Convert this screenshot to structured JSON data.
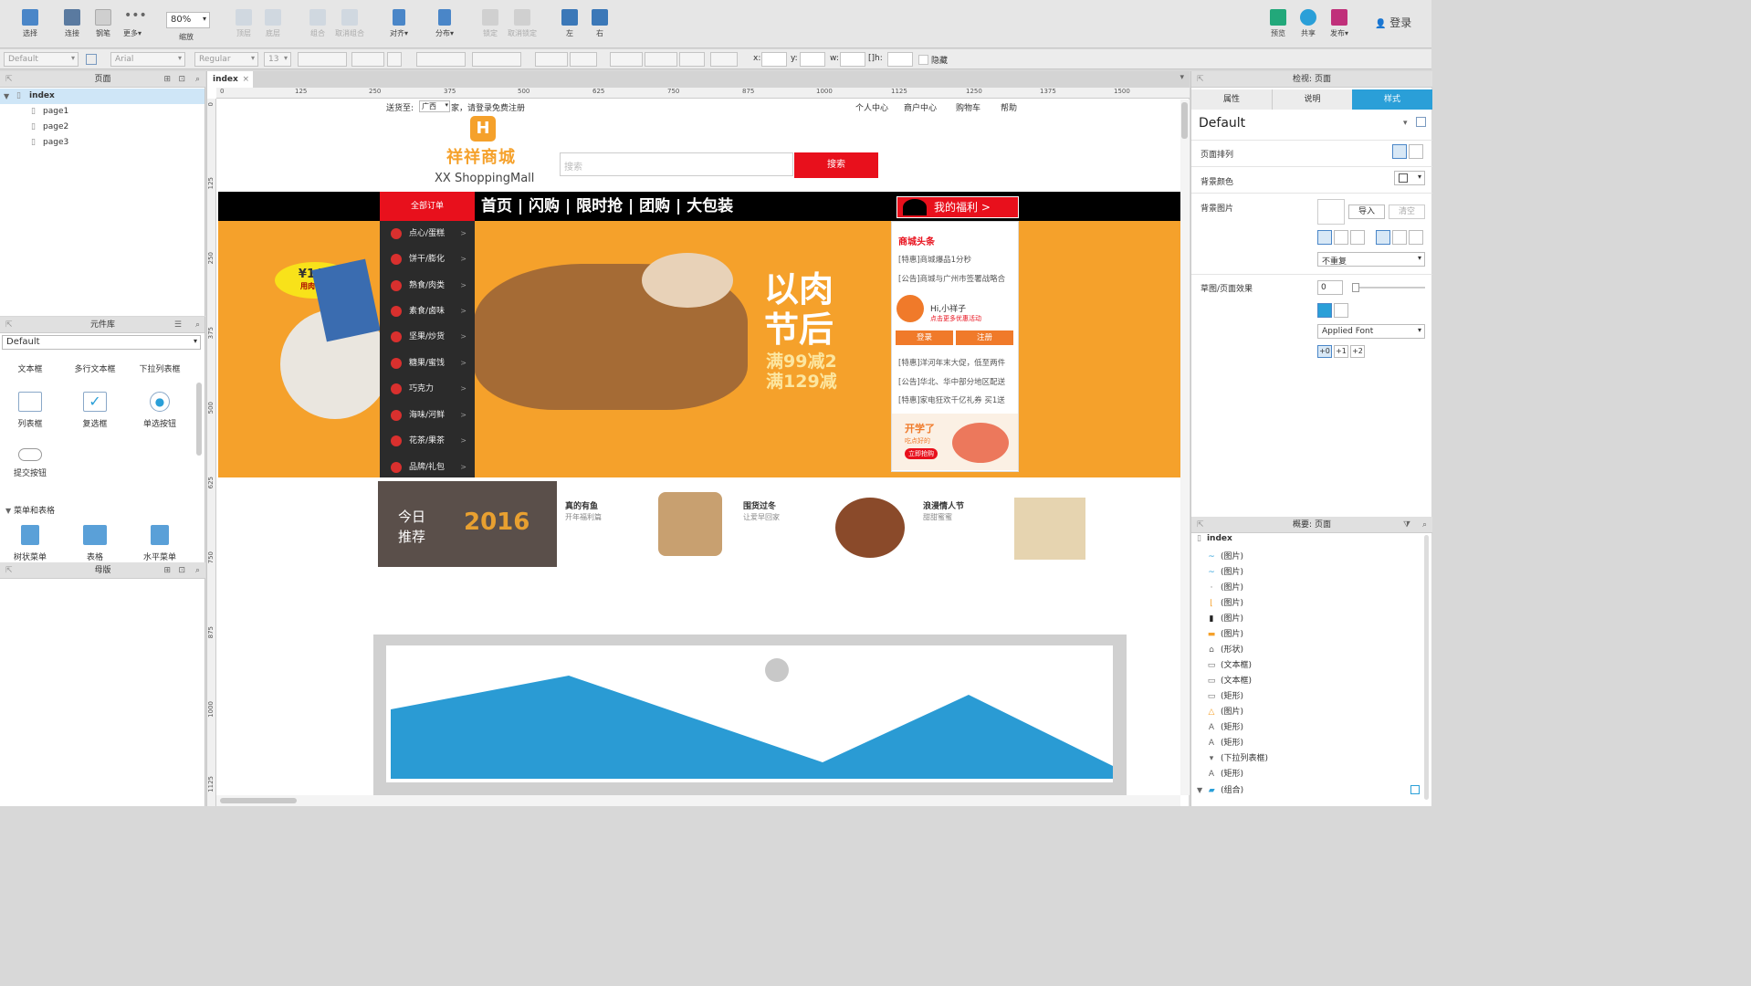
{
  "toolbar": {
    "items": [
      {
        "label": "选择",
        "icon": "select-icon"
      },
      {
        "label": "连接",
        "icon": "connect-icon"
      },
      {
        "label": "钢笔",
        "icon": "pen-icon"
      },
      {
        "label": "更多▾",
        "icon": "more-icon"
      },
      {
        "label": "缩放",
        "icon": "zoom-icon"
      },
      {
        "label": "顶层",
        "icon": "bring-front-icon"
      },
      {
        "label": "底层",
        "icon": "send-back-icon"
      },
      {
        "label": "组合",
        "icon": "group-icon"
      },
      {
        "label": "取消组合",
        "icon": "ungroup-icon"
      },
      {
        "label": "对齐▾",
        "icon": "align-icon"
      },
      {
        "label": "分布▾",
        "icon": "distribute-icon"
      },
      {
        "label": "锁定",
        "icon": "lock-icon"
      },
      {
        "label": "取消锁定",
        "icon": "unlock-icon"
      },
      {
        "label": "左",
        "icon": "align-left-icon"
      },
      {
        "label": "右",
        "icon": "align-right-icon"
      },
      {
        "label": "预览",
        "icon": "preview-icon"
      },
      {
        "label": "共享",
        "icon": "share-icon"
      },
      {
        "label": "发布▾",
        "icon": "publish-icon"
      }
    ],
    "zoom": "80%",
    "login": "登录"
  },
  "format": {
    "style": "Default",
    "font": "Arial",
    "weight": "Regular",
    "size": "13",
    "x_label": "x:",
    "y_label": "y:",
    "w_label": "w:",
    "h_label": "h:",
    "hidden_label": "隐藏"
  },
  "pages_panel": {
    "title": "页面",
    "root": "index",
    "pages": [
      "page1",
      "page2",
      "page3"
    ]
  },
  "library_panel": {
    "title": "元件库",
    "library": "Default",
    "row1": [
      "文本框",
      "多行文本框",
      "下拉列表框"
    ],
    "row2": [
      "列表框",
      "复选框",
      "单选按钮"
    ],
    "row3": [
      "提交按钮"
    ],
    "section": "菜单和表格",
    "row4": [
      "树状菜单",
      "表格",
      "水平菜单"
    ]
  },
  "masters_panel": {
    "title": "母版"
  },
  "canvas": {
    "tab": "index",
    "ruler_h": [
      "0",
      "125",
      "250",
      "375",
      "500",
      "625",
      "750",
      "875",
      "1000",
      "1125",
      "1250",
      "1375",
      "1500"
    ],
    "ruler_v": [
      "0",
      "125",
      "250",
      "375",
      "500",
      "625",
      "750",
      "875",
      "1000",
      "1125"
    ]
  },
  "mockup": {
    "topbar": {
      "ship_to": "送货至:",
      "province": "广西",
      "welcome": "家，请登录免费注册",
      "links": [
        "个人中心",
        "商户中心",
        "购物车",
        "帮助"
      ]
    },
    "logo_text": "祥祥商城",
    "logo_sub": "XX ShoppingMall",
    "search_placeholder": "搜索",
    "search_button": "搜索",
    "nav_all": "全部订单",
    "nav_items": [
      "首页",
      "闪购",
      "限时抢",
      "团购",
      "大包装"
    ],
    "welfare": "我的福利  >",
    "categories": [
      "点心/蛋糕",
      "饼干/膨化",
      "熟食/肉类",
      "素食/卤味",
      "坚果/炒货",
      "糖果/蜜饯",
      "巧克力",
      "海味/河鲜",
      "花茶/果茶",
      "品牌/礼包"
    ],
    "banner": {
      "price_tag": "¥148",
      "price_sub": "用肉食材",
      "headline1": "以肉",
      "headline2": "节后",
      "promo1": "满99减2",
      "promo2": "满129减"
    },
    "news": {
      "title": "商城头条",
      "items1": [
        "[特惠]商城爆品1分秒",
        "[公告]商城与广州市签署战略合"
      ],
      "hi": "Hi,小祥子",
      "hi_sub": "点击更多优惠活动",
      "login": "登录",
      "register": "注册",
      "items2": [
        "[特惠]洋河年末大促，低至两件",
        "[公告]华北、华中部分地区配送",
        "[特惠]家电狂欢千亿礼券 买1送"
      ],
      "promo_title": "开学了",
      "promo_sub": "吃点好的",
      "promo_btn": "立即抢购"
    },
    "today": {
      "label1": "今日",
      "label2": "推荐",
      "year": "2016",
      "products": [
        {
          "title": "真的有鱼",
          "sub": "开年福利篇"
        },
        {
          "title": "围货过冬",
          "sub": "让爱早回家"
        },
        {
          "title": "浪漫情人节",
          "sub": "甜甜蜜蜜"
        }
      ]
    }
  },
  "inspector": {
    "title": "检视: 页面",
    "tabs": [
      "属性",
      "说明",
      "样式"
    ],
    "active_tab": "样式",
    "style_name": "Default",
    "page_align": "页面排列",
    "bg_color": "背景颜色",
    "bg_image": "背景图片",
    "import": "导入",
    "clear": "清空",
    "repeat": "不重复",
    "sketch": "草图/页面效果",
    "sketch_value": "0",
    "font_select": "Applied Font",
    "font_steps": [
      "+0",
      "+1",
      "+2"
    ]
  },
  "outline": {
    "title": "概要: 页面",
    "root": "index",
    "items": [
      {
        "label": "(图片)",
        "icon": "image-icon"
      },
      {
        "label": "(图片)",
        "icon": "image-icon"
      },
      {
        "label": "(图片)",
        "icon": "image-icon"
      },
      {
        "label": "(图片)",
        "icon": "image-icon"
      },
      {
        "label": "(图片)",
        "icon": "image-icon"
      },
      {
        "label": "(图片)",
        "icon": "image-icon"
      },
      {
        "label": "(形状)",
        "icon": "shape-icon"
      },
      {
        "label": "(文本框)",
        "icon": "textbox-icon"
      },
      {
        "label": "(文本框)",
        "icon": "textbox-icon"
      },
      {
        "label": "(矩形)",
        "icon": "rect-icon"
      },
      {
        "label": "(图片)",
        "icon": "image-icon"
      },
      {
        "label": "(矩形)",
        "icon": "text-rect-icon"
      },
      {
        "label": "(矩形)",
        "icon": "text-rect-icon"
      },
      {
        "label": "(下拉列表框)",
        "icon": "dropdown-icon"
      },
      {
        "label": "(矩形)",
        "icon": "text-rect-icon"
      },
      {
        "label": "(组合)",
        "icon": "folder-icon"
      }
    ]
  },
  "colors": {
    "accent": "#2a9fd8",
    "mall_red": "#e8101c",
    "banner_orange": "#f5a12b",
    "nav_black": "#000000",
    "placeholder_blue": "#2a9bd4"
  }
}
